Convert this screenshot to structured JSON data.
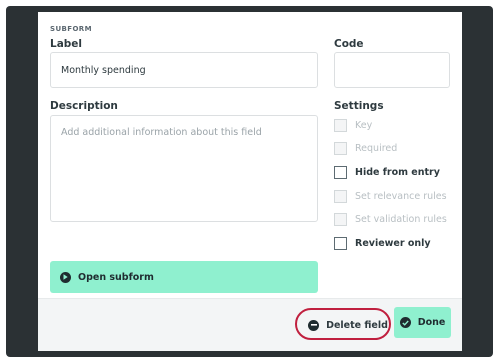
{
  "section": {
    "title": "SUBFORM"
  },
  "label_field": {
    "label": "Label",
    "value": "Monthly spending"
  },
  "code_field": {
    "label": "Code",
    "value": ""
  },
  "description_field": {
    "label": "Description",
    "placeholder": "Add additional information about this field"
  },
  "settings": {
    "title": "Settings",
    "items": [
      {
        "label": "Key",
        "enabled": false,
        "checked": false
      },
      {
        "label": "Required",
        "enabled": false,
        "checked": false
      },
      {
        "label": "Hide from entry",
        "enabled": true,
        "checked": false
      },
      {
        "label": "Set relevance rules",
        "enabled": false,
        "checked": false
      },
      {
        "label": "Set validation rules",
        "enabled": false,
        "checked": false
      },
      {
        "label": "Reviewer only",
        "enabled": true,
        "checked": false
      }
    ]
  },
  "open_subform": {
    "label": "Open subform",
    "icon": "play-circle-icon"
  },
  "footer": {
    "delete_label": "Delete field",
    "delete_icon": "minus-circle-icon",
    "done_label": "Done",
    "done_icon": "check-circle-icon"
  },
  "colors": {
    "accent": "#8ff0cf",
    "backdrop": "#2b3134",
    "highlight_ring": "#c0203f"
  }
}
